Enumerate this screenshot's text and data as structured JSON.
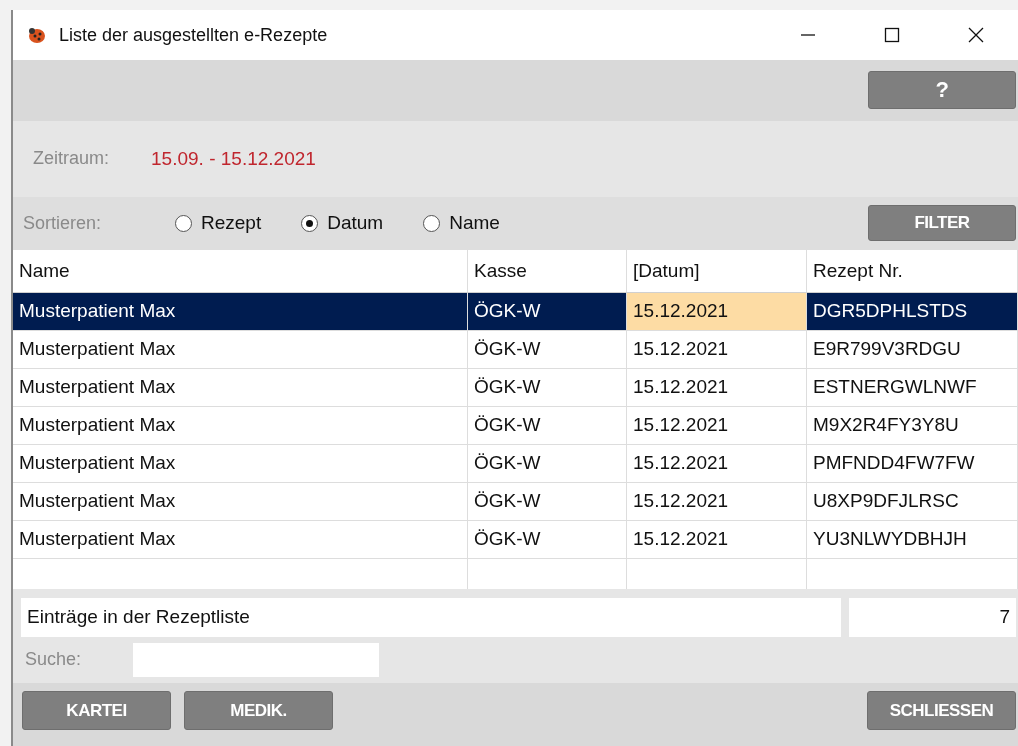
{
  "window": {
    "title": "Liste der ausgestellten e-Rezepte"
  },
  "toolbar": {
    "help_button": "?"
  },
  "period": {
    "label": "Zeitraum:",
    "value": "15.09. - 15.12.2021"
  },
  "sort": {
    "label": "Sortieren:",
    "options": [
      {
        "label": "Rezept",
        "selected": false
      },
      {
        "label": "Datum",
        "selected": true
      },
      {
        "label": "Name",
        "selected": false
      }
    ],
    "filter_button": "FILTER"
  },
  "table": {
    "columns": [
      {
        "label": "Name",
        "sorted": false
      },
      {
        "label": "Kasse",
        "sorted": false
      },
      {
        "label": "[Datum]",
        "sorted": true
      },
      {
        "label": "Rezept Nr.",
        "sorted": false
      }
    ],
    "rows": [
      {
        "selected": true,
        "cells": [
          "Musterpatient Max",
          "ÖGK-W",
          "15.12.2021",
          "DGR5DPHLSTDS"
        ]
      },
      {
        "selected": false,
        "cells": [
          "Musterpatient Max",
          "ÖGK-W",
          "15.12.2021",
          "E9R799V3RDGU"
        ]
      },
      {
        "selected": false,
        "cells": [
          "Musterpatient Max",
          "ÖGK-W",
          "15.12.2021",
          "ESTNERGWLNWF"
        ]
      },
      {
        "selected": false,
        "cells": [
          "Musterpatient Max",
          "ÖGK-W",
          "15.12.2021",
          "M9X2R4FY3Y8U"
        ]
      },
      {
        "selected": false,
        "cells": [
          "Musterpatient Max",
          "ÖGK-W",
          "15.12.2021",
          "PMFNDD4FW7FW"
        ]
      },
      {
        "selected": false,
        "cells": [
          "Musterpatient Max",
          "ÖGK-W",
          "15.12.2021",
          "U8XP9DFJLRSC"
        ]
      },
      {
        "selected": false,
        "cells": [
          "Musterpatient Max",
          "ÖGK-W",
          "15.12.2021",
          "YU3NLWYDBHJH"
        ]
      }
    ]
  },
  "summary": {
    "label": "Einträge in der Rezeptliste",
    "count": "7"
  },
  "search": {
    "label": "Suche:"
  },
  "buttons": [
    {
      "label": "KARTEI",
      "kind": "left"
    },
    {
      "label": "MEDIK.",
      "kind": "left"
    },
    {
      "label": "SCHLIESSEN",
      "kind": "right"
    }
  ]
}
